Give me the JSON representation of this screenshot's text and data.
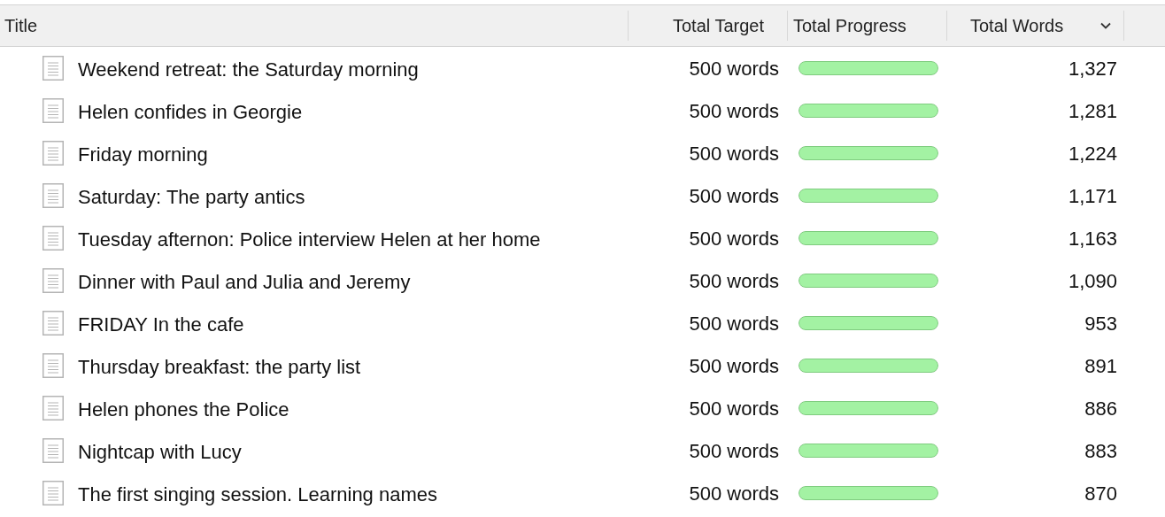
{
  "table": {
    "columns": [
      {
        "label": "Title",
        "sorted": false
      },
      {
        "label": "Total Target",
        "sorted": false
      },
      {
        "label": "Total Progress",
        "sorted": false
      },
      {
        "label": "Total Words",
        "sorted": true
      }
    ],
    "rows": [
      {
        "title": "Weekend retreat: the Saturday morning",
        "target": "500 words",
        "level": 1,
        "words": "1,327"
      },
      {
        "title": "Helen confides in Georgie",
        "target": "500 words",
        "level": 1,
        "words": "1,281"
      },
      {
        "title": "Friday morning",
        "target": "500 words",
        "level": 1,
        "words": "1,224"
      },
      {
        "title": "Saturday: The party antics",
        "target": "500 words",
        "level": 1,
        "words": "1,171"
      },
      {
        "title": "Tuesday afternon: Police interview Helen at her home",
        "target": "500 words",
        "level": 1,
        "words": "1,163"
      },
      {
        "title": "Dinner with Paul and Julia and Jeremy",
        "target": "500 words",
        "level": 1,
        "words": "1,090"
      },
      {
        "title": "FRIDAY In the cafe",
        "target": "500 words",
        "level": 1,
        "words": "953"
      },
      {
        "title": "Thursday breakfast: the party list",
        "target": "500 words",
        "level": 1,
        "words": "891"
      },
      {
        "title": "Helen phones the Police",
        "target": "500 words",
        "level": 1,
        "words": "886"
      },
      {
        "title": "Nightcap with Lucy",
        "target": "500 words",
        "level": 1,
        "words": "883"
      },
      {
        "title": "The first singing session. Learning names",
        "target": "500 words",
        "level": 1,
        "words": "870"
      }
    ]
  }
}
